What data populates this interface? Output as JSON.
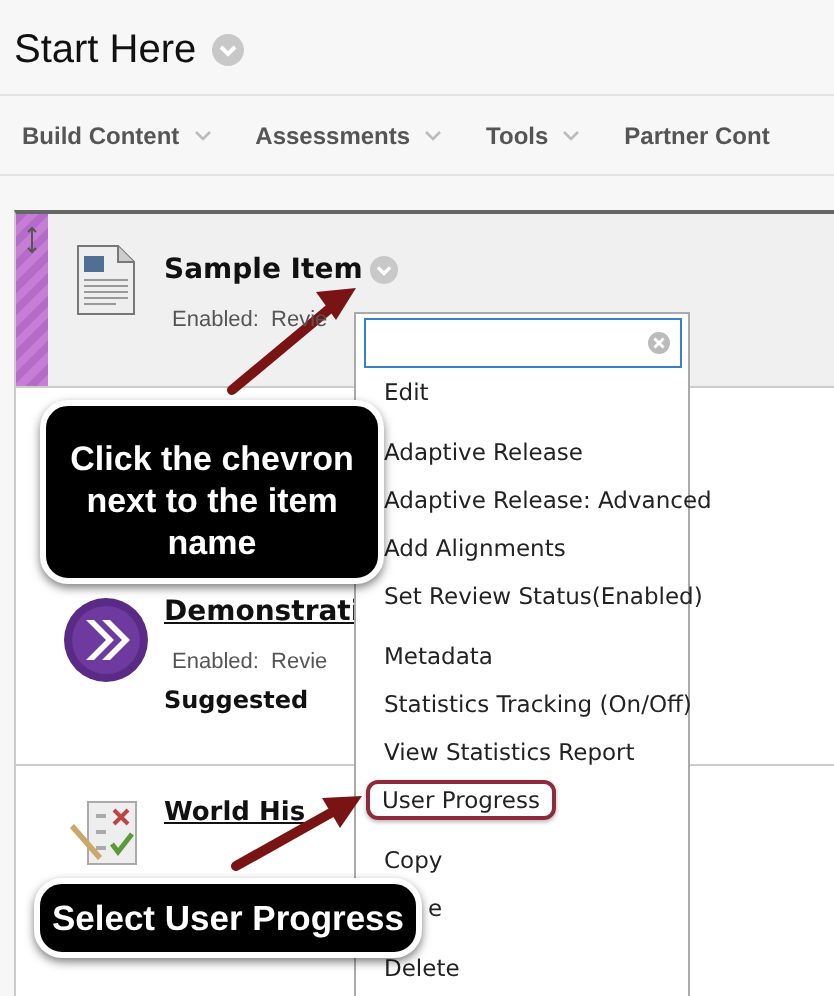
{
  "page_title": "Start Here",
  "toolbar": [
    {
      "label": "Build Content"
    },
    {
      "label": "Assessments"
    },
    {
      "label": "Tools"
    },
    {
      "label": "Partner Cont"
    }
  ],
  "items": [
    {
      "kind": "document",
      "title": "Sample Item",
      "linked": false,
      "selected": true,
      "status": "Enabled:  Revie"
    },
    {
      "kind": "module",
      "title": "Demonstrati",
      "linked": true,
      "selected": false,
      "status": "Enabled:  Revie",
      "note": "Suggested"
    },
    {
      "kind": "test",
      "title": "World His",
      "linked": true,
      "selected": false
    }
  ],
  "menu": {
    "groups": [
      [
        {
          "label": "Edit",
          "kind": "item",
          "highlighted": false
        }
      ],
      [
        {
          "label": "Adaptive Release",
          "kind": "item",
          "highlighted": false
        },
        {
          "label": "Adaptive Release: Advanced",
          "kind": "item",
          "highlighted": false
        },
        {
          "label": "Add Alignments",
          "kind": "item",
          "highlighted": false
        },
        {
          "label": "Set Review Status(Enabled)",
          "kind": "item",
          "highlighted": false
        }
      ],
      [
        {
          "label": "Metadata",
          "kind": "item",
          "highlighted": false
        },
        {
          "label": "Statistics Tracking (On/Off)",
          "kind": "item",
          "highlighted": false
        },
        {
          "label": "View Statistics Report",
          "kind": "item",
          "highlighted": false
        },
        {
          "label": "User Progress",
          "kind": "item",
          "highlighted": true
        }
      ],
      [
        {
          "label": "Copy",
          "kind": "item",
          "highlighted": false
        },
        {
          "label": "e",
          "kind": "partial",
          "highlighted": false
        }
      ],
      [
        {
          "label": "Delete",
          "kind": "item",
          "highlighted": false
        }
      ]
    ]
  },
  "callouts": [
    {
      "text": "Click the chevron next to the item name",
      "kind": "large"
    },
    {
      "text": "Select User Progress",
      "kind": "bar"
    }
  ]
}
